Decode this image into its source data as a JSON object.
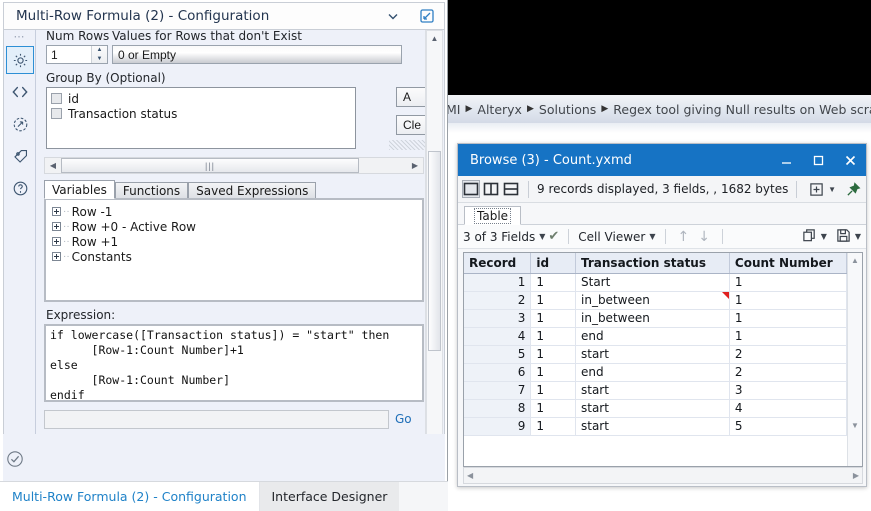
{
  "background": {
    "breadcrumb": [
      "MI",
      "Alteryx",
      "Solutions",
      "Regex tool giving Null results on Web scraping w"
    ]
  },
  "config_panel": {
    "title": "Multi-Row Formula (2) - Configuration",
    "collapse_icon": "chevron-down-icon",
    "popout_icon": "popout-arrow-icon",
    "rail_icons": [
      "gear-icon",
      "code-icon",
      "arrow-circle-icon",
      "tag-icon",
      "help-icon"
    ],
    "num_rows_label": "Num Rows",
    "num_rows_value": "1",
    "values_label": "Values for Rows that don't Exist",
    "values_selected": "0 or Empty",
    "group_by_label": "Group By (Optional)",
    "group_by_items": [
      {
        "label": "id",
        "checked": false
      },
      {
        "label": "Transaction status",
        "checked": false
      }
    ],
    "add_button": "A",
    "clear_button": "Cle",
    "tabs": [
      {
        "label": "Variables",
        "active": true
      },
      {
        "label": "Functions",
        "active": false
      },
      {
        "label": "Saved Expressions",
        "active": false
      }
    ],
    "tree_items": [
      "Row -1",
      "Row +0 - Active Row",
      "Row +1",
      "Constants"
    ],
    "expression_label": "Expression:",
    "expression": "if lowercase([Transaction status]) = \"start\" then\n      [Row-1:Count Number]+1\nelse\n      [Row-1:Count Number]\nendif",
    "find_value": "",
    "go_label": "Go",
    "status_icon": "check-circle-icon",
    "bottom_tabs": [
      {
        "label": "Multi-Row Formula (2) - Configuration",
        "active": true
      },
      {
        "label": "Interface Designer",
        "active": false
      }
    ]
  },
  "browse_window": {
    "title": "Browse (3) - Count.yxmd",
    "window_buttons": [
      "minimize-icon",
      "maximize-icon",
      "close-icon"
    ],
    "view_icons": [
      "single-pane-icon",
      "two-column-icon",
      "two-row-icon"
    ],
    "record_info": "9 records displayed, 3 fields, , 1682 bytes",
    "add_icon": "add-box-icon",
    "pin_icon": "pin-icon",
    "tab_label": "Table",
    "fields_selector": "3 of 3 Fields",
    "fields_check_icon": "check-icon",
    "cell_viewer": "Cell Viewer",
    "up_icon": "arrow-up-icon",
    "down_icon": "arrow-down-icon",
    "copy_icon": "copy-icon",
    "save_icon": "save-icon",
    "grid": {
      "columns": [
        "Record",
        "id",
        "Transaction status",
        "Count Number"
      ],
      "rows": [
        {
          "record": "1",
          "id": "1",
          "status": "Start",
          "count": "1",
          "marker": false
        },
        {
          "record": "2",
          "id": "1",
          "status": "in_between",
          "count": "1",
          "marker": true
        },
        {
          "record": "3",
          "id": "1",
          "status": "in_between",
          "count": "1",
          "marker": false
        },
        {
          "record": "4",
          "id": "1",
          "status": "end",
          "count": "1",
          "marker": false
        },
        {
          "record": "5",
          "id": "1",
          "status": "start",
          "count": "2",
          "marker": false
        },
        {
          "record": "6",
          "id": "1",
          "status": "end",
          "count": "2",
          "marker": false
        },
        {
          "record": "7",
          "id": "1",
          "status": "start",
          "count": "3",
          "marker": false
        },
        {
          "record": "8",
          "id": "1",
          "status": "start",
          "count": "4",
          "marker": false
        },
        {
          "record": "9",
          "id": "1",
          "status": "start",
          "count": "5",
          "marker": false
        }
      ]
    }
  },
  "colors": {
    "title_blue": "#1673c4",
    "accent_link": "#1f82c8",
    "panel_bg": "#eef1f9",
    "marker_red": "#e02020"
  }
}
